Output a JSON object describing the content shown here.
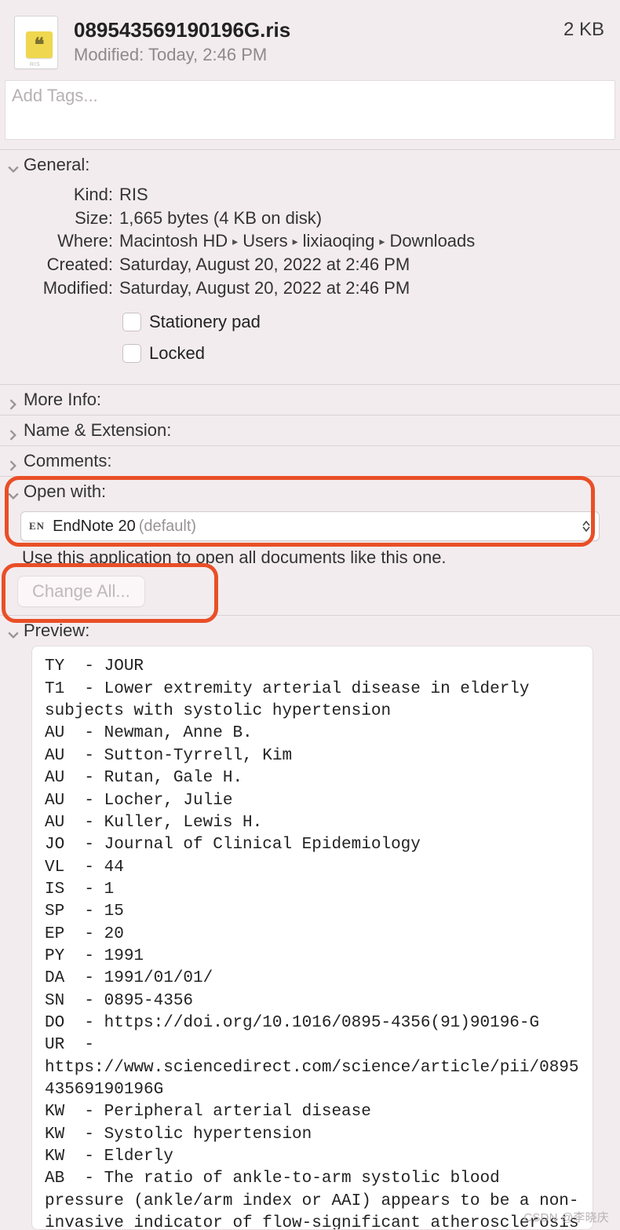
{
  "header": {
    "filename": "089543569190196G.ris",
    "modified_line": "Modified:  Today, 2:46 PM",
    "size_short": "2 KB",
    "icon_ext": "RIS",
    "icon_glyph": "❝"
  },
  "tags_placeholder": "Add Tags...",
  "sections": {
    "general": "General:",
    "more_info": "More Info:",
    "name_ext": "Name & Extension:",
    "comments": "Comments:",
    "open_with": "Open with:",
    "preview": "Preview:"
  },
  "general": {
    "kind_label": "Kind:",
    "kind": "RIS",
    "size_label": "Size:",
    "size": "1,665 bytes (4 KB on disk)",
    "where_label": "Where:",
    "where_parts": [
      "Macintosh HD",
      "Users",
      "lixiaoqing",
      "Downloads"
    ],
    "created_label": "Created:",
    "created": "Saturday, August 20, 2022 at 2:46 PM",
    "modified_label": "Modified:",
    "modified": "Saturday, August 20, 2022 at 2:46 PM",
    "stationery_label": "Stationery pad",
    "locked_label": "Locked"
  },
  "open_with": {
    "app_code": "EN",
    "app_name": "EndNote 20",
    "default_suffix": "(default)",
    "hint": "Use this application to open all documents like this one.",
    "change_all": "Change All..."
  },
  "preview_text": "TY  - JOUR\nT1  - Lower extremity arterial disease in elderly subjects with systolic hypertension\nAU  - Newman, Anne B.\nAU  - Sutton-Tyrrell, Kim\nAU  - Rutan, Gale H.\nAU  - Locher, Julie\nAU  - Kuller, Lewis H.\nJO  - Journal of Clinical Epidemiology\nVL  - 44\nIS  - 1\nSP  - 15\nEP  - 20\nPY  - 1991\nDA  - 1991/01/01/\nSN  - 0895-4356\nDO  - https://doi.org/10.1016/0895-4356(91)90196-G\nUR  - https://www.sciencedirect.com/science/article/pii/089543569190196G\nKW  - Peripheral arterial disease\nKW  - Systolic hypertension\nKW  - Elderly\nAB  - The ratio of ankle-to-arm systolic blood pressure (ankle/arm index or AAI) appears to be a non-invasive indicator of flow-significant atherosclerosis and may be a useful measure of burden of disease in a high risk population. The prevalence of lower extremity arterial disease (LEAD) was",
  "watermark": "CSDN @李晓庆"
}
